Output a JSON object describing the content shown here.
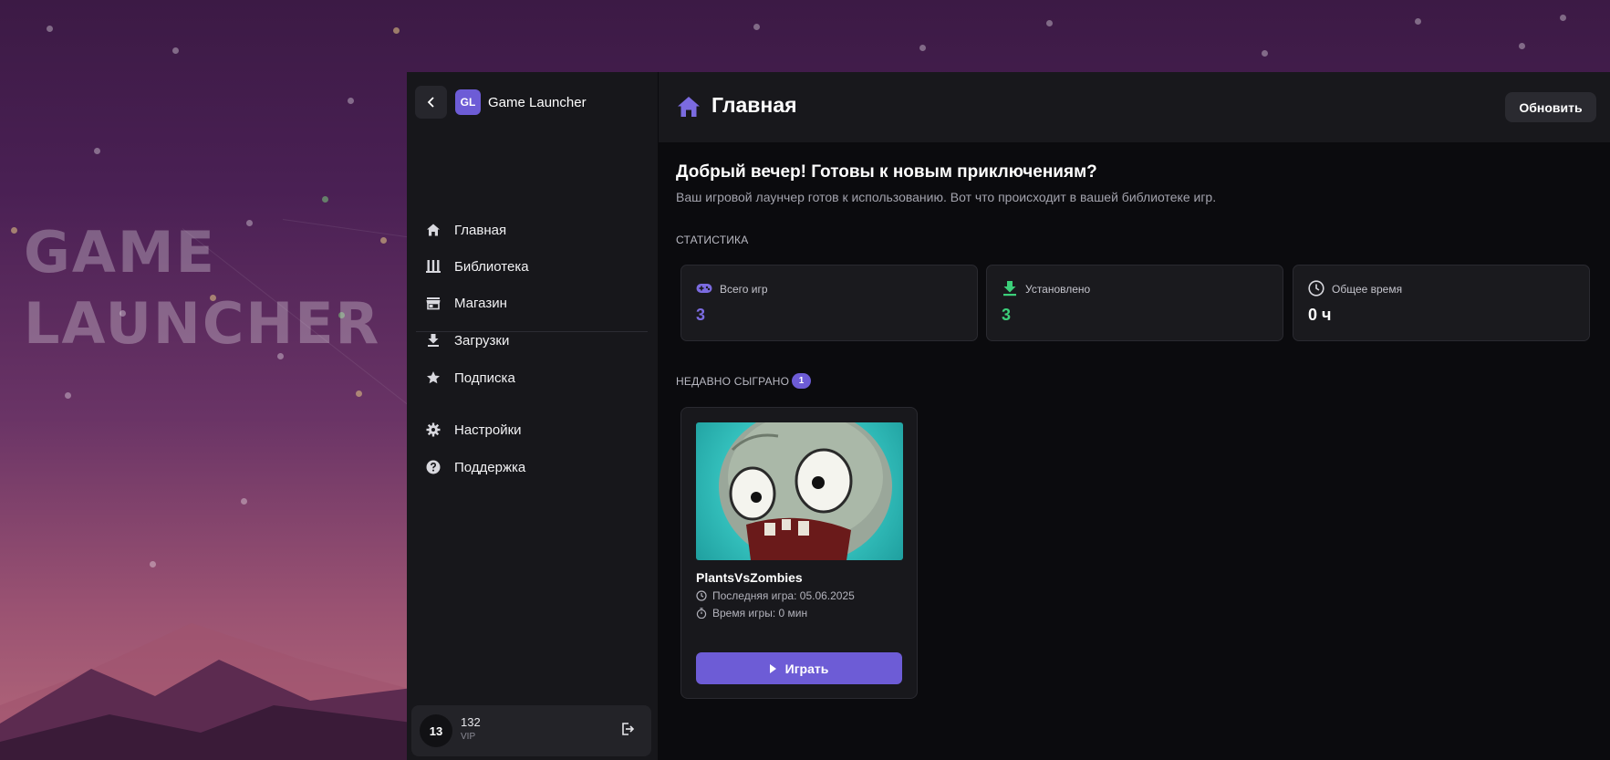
{
  "background": {
    "brand_line1": "GAME",
    "brand_line2": "LAUNCHER"
  },
  "sidebar": {
    "logo": "GL",
    "app_name": "Game Launcher",
    "items": [
      {
        "label": "Главная",
        "icon": "home-icon"
      },
      {
        "label": "Библиотека",
        "icon": "library-icon"
      },
      {
        "label": "Магазин",
        "icon": "store-icon"
      },
      {
        "label": "Загрузки",
        "icon": "download-icon"
      },
      {
        "label": "Подписка",
        "icon": "star-icon"
      }
    ],
    "secondary_items": [
      {
        "label": "Настройки",
        "icon": "gear-icon"
      },
      {
        "label": "Поддержка",
        "icon": "help-icon"
      }
    ],
    "user": {
      "avatar_text": "13",
      "name": "132",
      "role": "VIP"
    }
  },
  "header": {
    "title": "Главная",
    "refresh_label": "Обновить"
  },
  "main": {
    "greeting": "Добрый вечер! Готовы к новым приключениям?",
    "greeting_sub": "Ваш игровой лаунчер готов к использованию. Вот что происходит в вашей библиотеке игр.",
    "stats_label": "Статистика",
    "stats": [
      {
        "label": "Всего игр",
        "value": "3",
        "icon": "gamepad-icon",
        "color": "#7b6be0"
      },
      {
        "label": "Установлено",
        "value": "3",
        "icon": "download-icon",
        "color": "#3ccf7a"
      },
      {
        "label": "Общее время",
        "value": "0 ч",
        "icon": "clock-icon",
        "color": "#ffffff"
      }
    ],
    "recent_label": "Недавно сыграно",
    "recent_count": "1",
    "recent_game": {
      "title": "PlantsVsZombies",
      "last_played": "Последняя игра: 05.06.2025",
      "play_time": "Время игры: 0 мин",
      "play_label": "Играть"
    }
  },
  "colors": {
    "accent": "#6d5cd6",
    "sidebar_bg": "#17171b",
    "main_bg": "#0b0b0e"
  }
}
